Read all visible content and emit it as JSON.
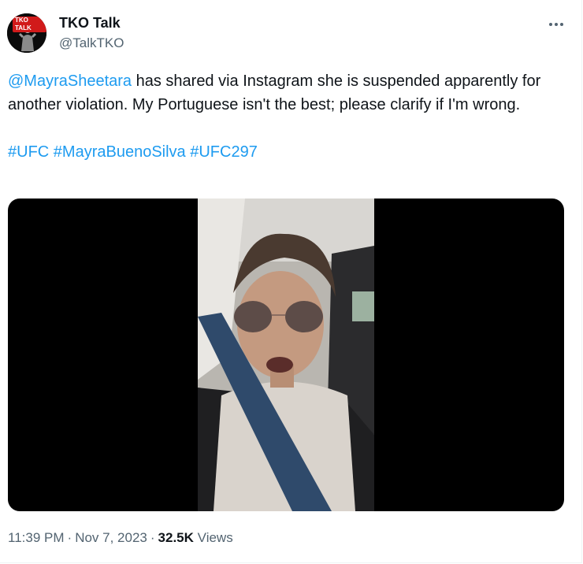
{
  "author": {
    "display_name": "TKO Talk",
    "handle": "@TalkTKO",
    "avatar_badge": "TKO TALK"
  },
  "tweet": {
    "mention": "@MayraSheetara",
    "body": " has shared via Instagram she is suspended apparently for another violation. My Portuguese isn't the best; please clarify if I'm wrong.",
    "hashtags": [
      "#UFC",
      "#MayraBuenoSilva",
      "#UFC297"
    ]
  },
  "meta": {
    "time": "11:39 PM",
    "date": "Nov 7, 2023",
    "views_count": "32.5K",
    "views_label": "Views",
    "separator": "·"
  },
  "icons": {
    "more": "more-horizontal-icon"
  },
  "colors": {
    "link": "#1d9bf0",
    "text": "#0f1419",
    "secondary": "#536471",
    "media_bg": "#000000"
  }
}
